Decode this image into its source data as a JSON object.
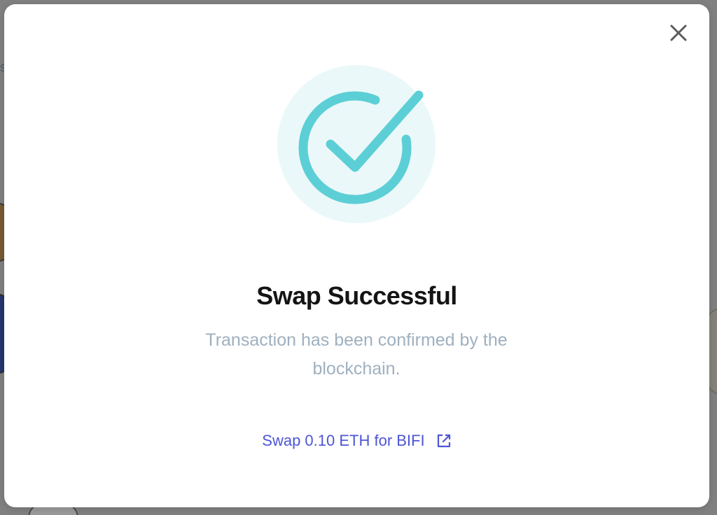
{
  "modal": {
    "title": "Swap Successful",
    "message": "Transaction has been confirmed by the blockchain.",
    "link_label": "Swap 0.10 ETH for BIFI",
    "icons": {
      "close": "close-icon",
      "success": "check-circle-icon",
      "external": "external-link-icon"
    }
  },
  "colors": {
    "accent_teal": "#5ccfd6",
    "accent_teal_bg": "#ebf8f9",
    "link_blue": "#4d55d6",
    "subtitle_gray": "#9fb0bf",
    "title_dark": "#141414"
  }
}
